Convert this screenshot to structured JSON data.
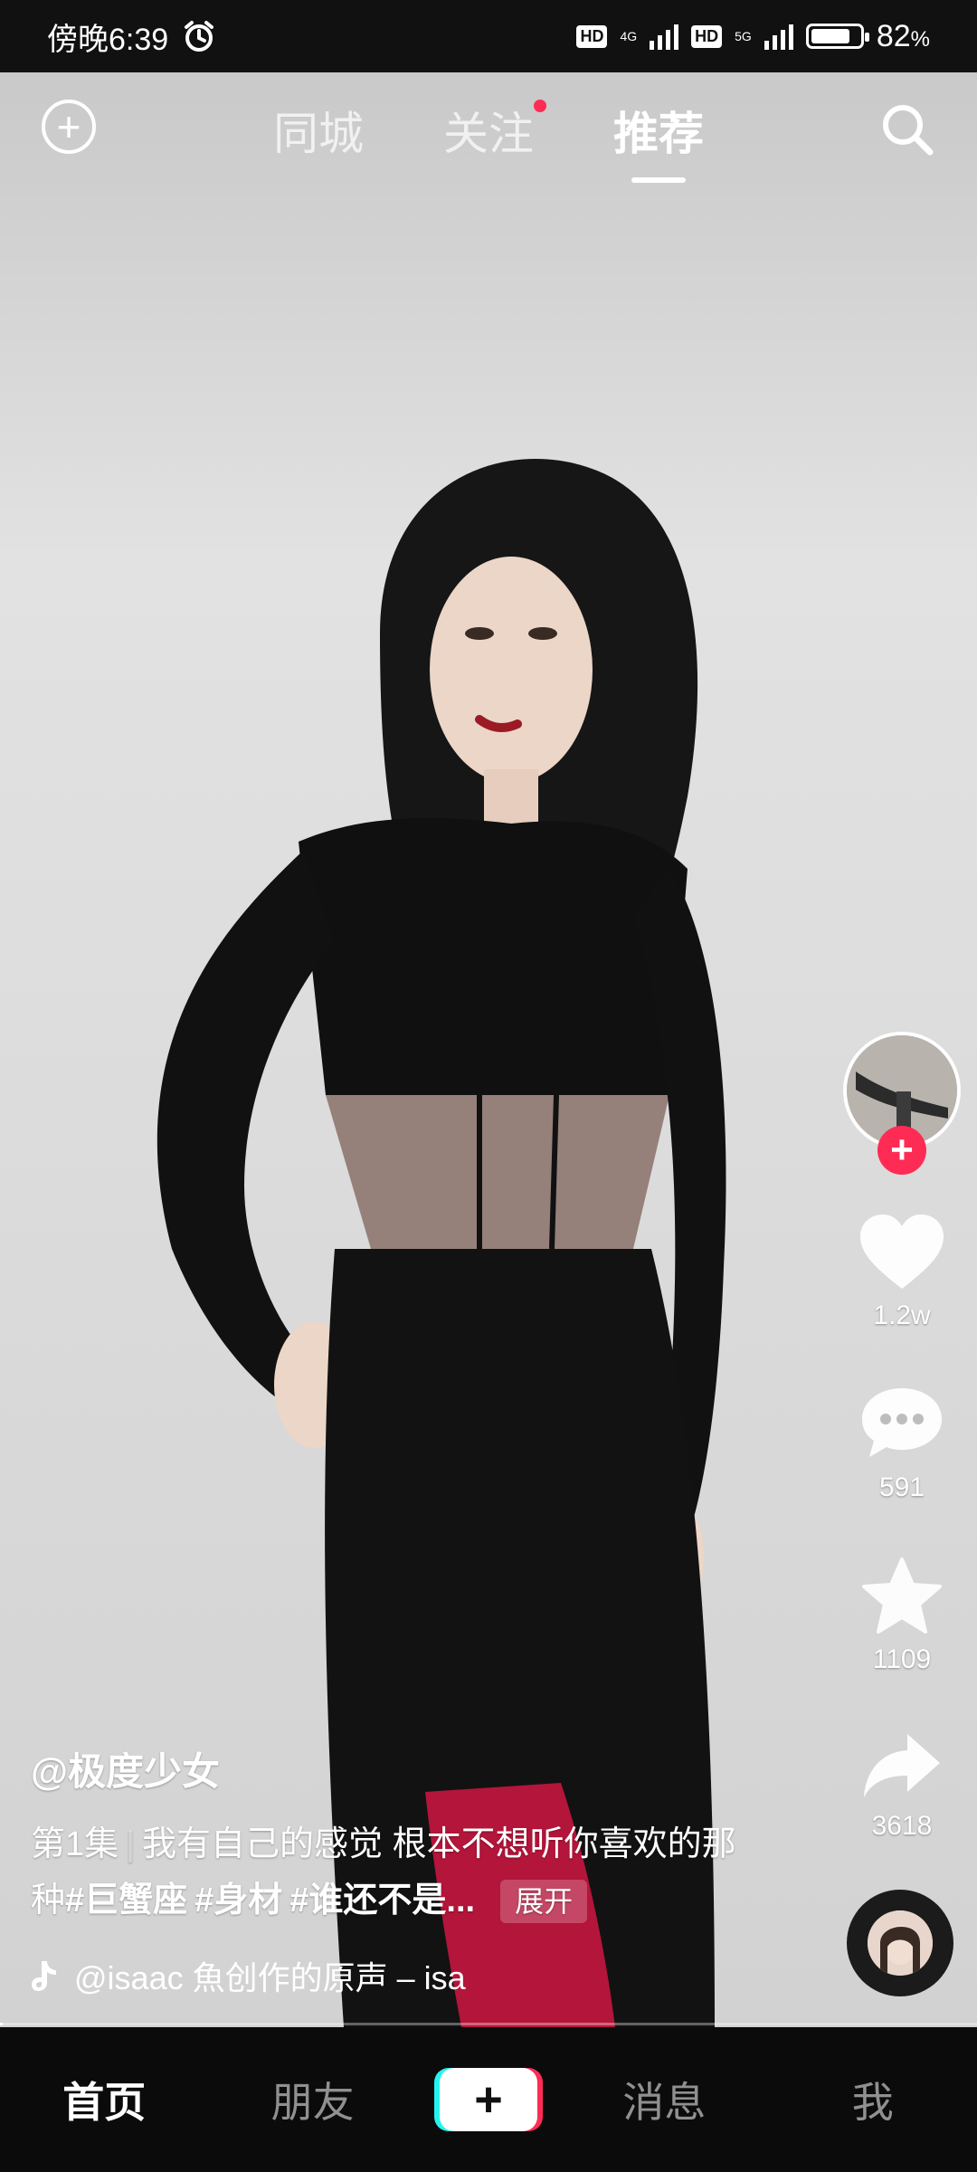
{
  "status_bar": {
    "time": "傍晚6:39",
    "alarm_icon": "alarm-icon",
    "network1": "4G",
    "network2": "5G",
    "hd": "HD",
    "battery_percent": "82",
    "battery_unit": "%",
    "battery_level": 0.82
  },
  "top_nav": {
    "tabs": [
      {
        "label": "同城"
      },
      {
        "label": "关注"
      },
      {
        "label": "推荐"
      }
    ],
    "active_tab": "推荐"
  },
  "actions": {
    "likes": "1.2w",
    "comments": "591",
    "favorites": "1109",
    "shares": "3618"
  },
  "caption": {
    "author": "@极度少女",
    "episode": "第1集",
    "text": "我有自己的感觉 根本不想听你喜欢的那种",
    "hashtags": [
      "#巨蟹座",
      "#身材",
      "#谁还不是..."
    ],
    "expand_label": "展开",
    "music": "@isaac 魚创作的原声 – isa"
  },
  "progress": 0.003,
  "bottom_nav": {
    "home": "首页",
    "friends": "朋友",
    "messages": "消息",
    "me": "我"
  },
  "colors": {
    "accent_red": "#fe2c55",
    "accent_cyan": "#25f4ee"
  }
}
